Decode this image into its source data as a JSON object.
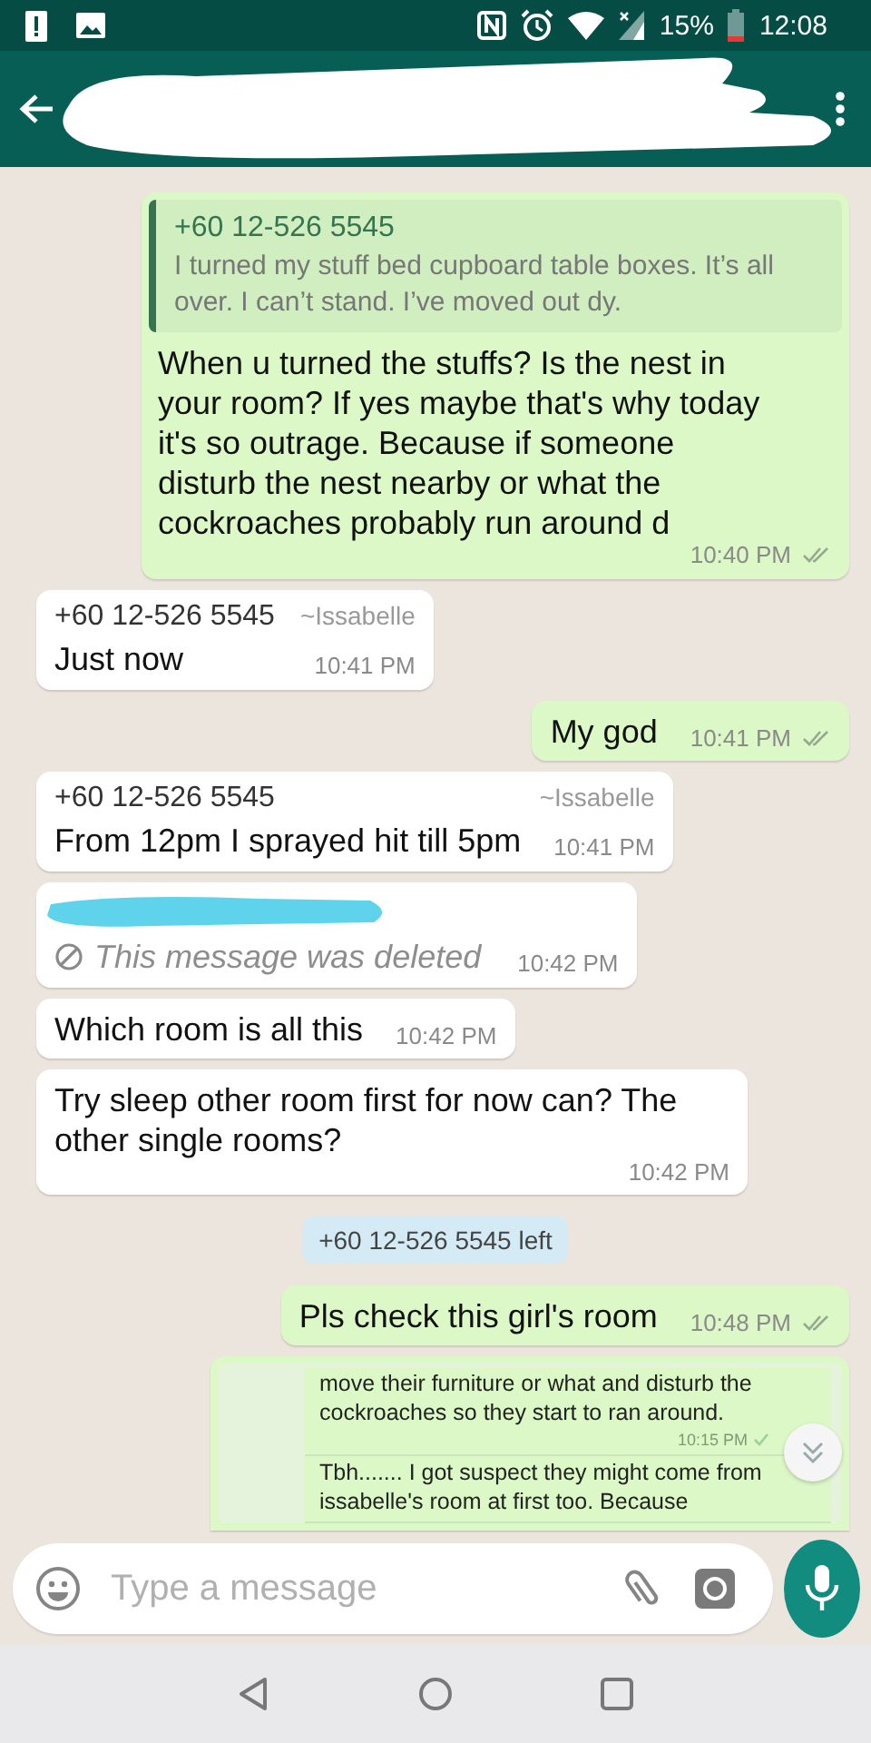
{
  "status_bar": {
    "battery": "15%",
    "time": "12:08"
  },
  "messages": [
    {
      "kind": "quote",
      "quote_sender": "+60 12-526 5545",
      "quote_text": "I turned my stuff bed cupboard table boxes. It’s all over. I can’t stand. I’ve moved out dy.",
      "text": "When u turned the stuffs? Is the nest in your room? If yes maybe that's why today it's so outrage. Because if someone disturb the nest nearby or what the cockroaches probably run around d",
      "time": "10:40 PM",
      "delivered": true
    },
    {
      "kind": "incoming",
      "sender": "+60 12-526 5545",
      "alias": "~Issabelle",
      "text": "Just now",
      "time": "10:41 PM"
    },
    {
      "kind": "outgoing",
      "text": "My god",
      "time": "10:41 PM",
      "delivered": true
    },
    {
      "kind": "incoming",
      "sender": "+60 12-526 5545",
      "alias": "~Issabelle",
      "text": "From 12pm I sprayed hit till 5pm",
      "time": "10:41 PM"
    },
    {
      "kind": "deleted",
      "text": "This message was deleted",
      "time": "10:42 PM"
    },
    {
      "kind": "incoming",
      "text": "Which room is all this",
      "time": "10:42 PM"
    },
    {
      "kind": "incoming",
      "text": "Try sleep other room first for now can? The other single rooms?",
      "time": "10:42 PM"
    },
    {
      "kind": "system",
      "text": "+60 12-526 5545 left"
    },
    {
      "kind": "outgoing",
      "text": "Pls check this girl's room",
      "time": "10:48 PM",
      "delivered": true
    },
    {
      "kind": "screenshot",
      "items": [
        {
          "text": "move their furniture or what and disturb the cockroaches so they start to ran around.",
          "time": "10:15 PM"
        },
        {
          "text": "Tbh....... I got suspect they might come from issabelle's room at first too. Because"
        }
      ]
    }
  ],
  "composer": {
    "placeholder": "Type a message"
  }
}
